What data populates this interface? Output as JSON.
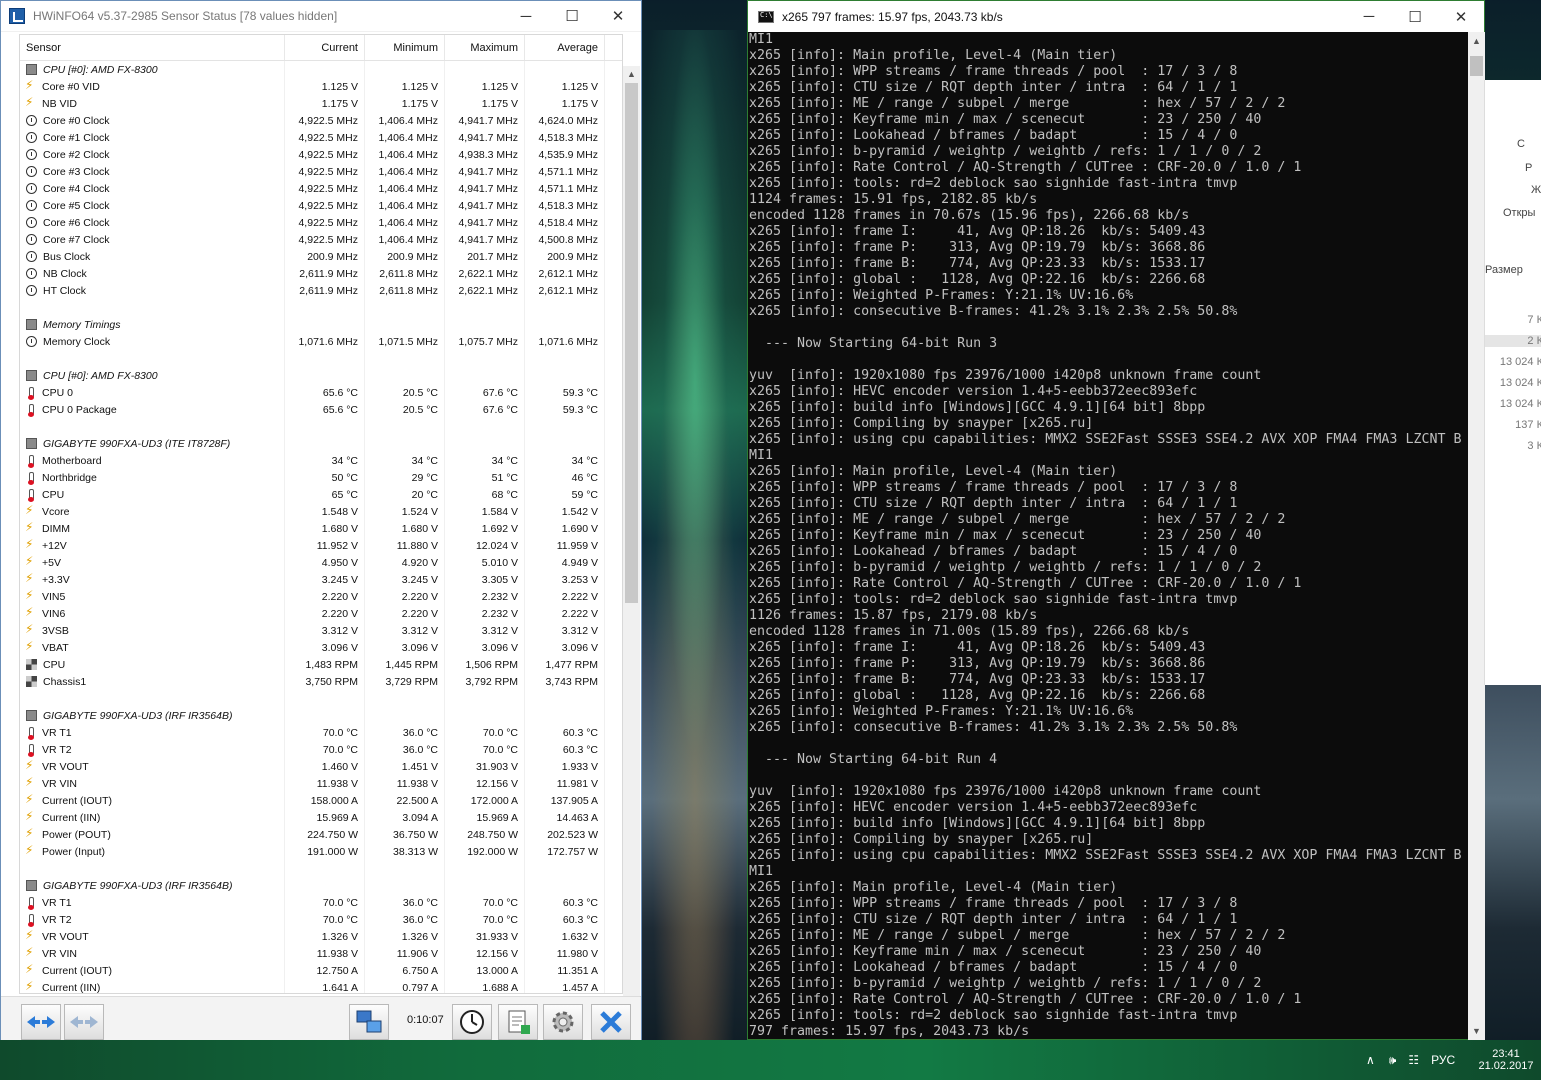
{
  "hwinfo": {
    "title": "HWiNFO64 v5.37-2985 Sensor Status [78 values hidden]",
    "columns": [
      "Sensor",
      "Current",
      "Minimum",
      "Maximum",
      "Average"
    ],
    "rows": [
      {
        "type": "group",
        "icon": "chip-icon",
        "label": "CPU [#0]: AMD FX-8300",
        "cur": "",
        "min": "",
        "max": "",
        "avg": ""
      },
      {
        "type": "row",
        "icon": "voltage-icon",
        "label": "Core #0 VID",
        "cur": "1.125 V",
        "min": "1.125 V",
        "max": "1.125 V",
        "avg": "1.125 V"
      },
      {
        "type": "row",
        "icon": "voltage-icon",
        "label": "NB VID",
        "cur": "1.175 V",
        "min": "1.175 V",
        "max": "1.175 V",
        "avg": "1.175 V"
      },
      {
        "type": "row",
        "icon": "clock-icon",
        "label": "Core #0 Clock",
        "cur": "4,922.5 MHz",
        "min": "1,406.4 MHz",
        "max": "4,941.7 MHz",
        "avg": "4,624.0 MHz"
      },
      {
        "type": "row",
        "icon": "clock-icon",
        "label": "Core #1 Clock",
        "cur": "4,922.5 MHz",
        "min": "1,406.4 MHz",
        "max": "4,941.7 MHz",
        "avg": "4,518.3 MHz"
      },
      {
        "type": "row",
        "icon": "clock-icon",
        "label": "Core #2 Clock",
        "cur": "4,922.5 MHz",
        "min": "1,406.4 MHz",
        "max": "4,938.3 MHz",
        "avg": "4,535.9 MHz"
      },
      {
        "type": "row",
        "icon": "clock-icon",
        "label": "Core #3 Clock",
        "cur": "4,922.5 MHz",
        "min": "1,406.4 MHz",
        "max": "4,941.7 MHz",
        "avg": "4,571.1 MHz"
      },
      {
        "type": "row",
        "icon": "clock-icon",
        "label": "Core #4 Clock",
        "cur": "4,922.5 MHz",
        "min": "1,406.4 MHz",
        "max": "4,941.7 MHz",
        "avg": "4,571.1 MHz"
      },
      {
        "type": "row",
        "icon": "clock-icon",
        "label": "Core #5 Clock",
        "cur": "4,922.5 MHz",
        "min": "1,406.4 MHz",
        "max": "4,941.7 MHz",
        "avg": "4,518.3 MHz"
      },
      {
        "type": "row",
        "icon": "clock-icon",
        "label": "Core #6 Clock",
        "cur": "4,922.5 MHz",
        "min": "1,406.4 MHz",
        "max": "4,941.7 MHz",
        "avg": "4,518.4 MHz"
      },
      {
        "type": "row",
        "icon": "clock-icon",
        "label": "Core #7 Clock",
        "cur": "4,922.5 MHz",
        "min": "1,406.4 MHz",
        "max": "4,941.7 MHz",
        "avg": "4,500.8 MHz"
      },
      {
        "type": "row",
        "icon": "clock-icon",
        "label": "Bus Clock",
        "cur": "200.9 MHz",
        "min": "200.9 MHz",
        "max": "201.7 MHz",
        "avg": "200.9 MHz"
      },
      {
        "type": "row",
        "icon": "clock-icon",
        "label": "NB Clock",
        "cur": "2,611.9 MHz",
        "min": "2,611.8 MHz",
        "max": "2,622.1 MHz",
        "avg": "2,612.1 MHz"
      },
      {
        "type": "row",
        "icon": "clock-icon",
        "label": "HT Clock",
        "cur": "2,611.9 MHz",
        "min": "2,611.8 MHz",
        "max": "2,622.1 MHz",
        "avg": "2,612.1 MHz"
      },
      {
        "type": "blank",
        "icon": "",
        "label": "",
        "cur": "",
        "min": "",
        "max": "",
        "avg": ""
      },
      {
        "type": "group",
        "icon": "chip-icon",
        "label": "Memory Timings",
        "cur": "",
        "min": "",
        "max": "",
        "avg": ""
      },
      {
        "type": "row",
        "icon": "clock-icon",
        "label": "Memory Clock",
        "cur": "1,071.6 MHz",
        "min": "1,071.5 MHz",
        "max": "1,075.7 MHz",
        "avg": "1,071.6 MHz"
      },
      {
        "type": "blank",
        "icon": "",
        "label": "",
        "cur": "",
        "min": "",
        "max": "",
        "avg": ""
      },
      {
        "type": "group",
        "icon": "chip-icon",
        "label": "CPU [#0]: AMD FX-8300",
        "cur": "",
        "min": "",
        "max": "",
        "avg": ""
      },
      {
        "type": "row",
        "icon": "thermometer-icon",
        "label": "CPU 0",
        "cur": "65.6 °C",
        "min": "20.5 °C",
        "max": "67.6 °C",
        "avg": "59.3 °C"
      },
      {
        "type": "row",
        "icon": "thermometer-icon",
        "label": "CPU 0 Package",
        "cur": "65.6 °C",
        "min": "20.5 °C",
        "max": "67.6 °C",
        "avg": "59.3 °C"
      },
      {
        "type": "blank",
        "icon": "",
        "label": "",
        "cur": "",
        "min": "",
        "max": "",
        "avg": ""
      },
      {
        "type": "group",
        "icon": "chip-icon",
        "label": "GIGABYTE 990FXA-UD3 (ITE IT8728F)",
        "cur": "",
        "min": "",
        "max": "",
        "avg": ""
      },
      {
        "type": "row",
        "icon": "thermometer-icon",
        "label": "Motherboard",
        "cur": "34 °C",
        "min": "34 °C",
        "max": "34 °C",
        "avg": "34 °C"
      },
      {
        "type": "row",
        "icon": "thermometer-icon",
        "label": "Northbridge",
        "cur": "50 °C",
        "min": "29 °C",
        "max": "51 °C",
        "avg": "46 °C"
      },
      {
        "type": "row",
        "icon": "thermometer-icon",
        "label": "CPU",
        "cur": "65 °C",
        "min": "20 °C",
        "max": "68 °C",
        "avg": "59 °C"
      },
      {
        "type": "row",
        "icon": "voltage-icon",
        "label": "Vcore",
        "cur": "1.548 V",
        "min": "1.524 V",
        "max": "1.584 V",
        "avg": "1.542 V"
      },
      {
        "type": "row",
        "icon": "voltage-icon",
        "label": "DIMM",
        "cur": "1.680 V",
        "min": "1.680 V",
        "max": "1.692 V",
        "avg": "1.690 V"
      },
      {
        "type": "row",
        "icon": "voltage-icon",
        "label": "+12V",
        "cur": "11.952 V",
        "min": "11.880 V",
        "max": "12.024 V",
        "avg": "11.959 V"
      },
      {
        "type": "row",
        "icon": "voltage-icon",
        "label": "+5V",
        "cur": "4.950 V",
        "min": "4.920 V",
        "max": "5.010 V",
        "avg": "4.949 V"
      },
      {
        "type": "row",
        "icon": "voltage-icon",
        "label": "+3.3V",
        "cur": "3.245 V",
        "min": "3.245 V",
        "max": "3.305 V",
        "avg": "3.253 V"
      },
      {
        "type": "row",
        "icon": "voltage-icon",
        "label": "VIN5",
        "cur": "2.220 V",
        "min": "2.220 V",
        "max": "2.232 V",
        "avg": "2.222 V"
      },
      {
        "type": "row",
        "icon": "voltage-icon",
        "label": "VIN6",
        "cur": "2.220 V",
        "min": "2.220 V",
        "max": "2.232 V",
        "avg": "2.222 V"
      },
      {
        "type": "row",
        "icon": "voltage-icon",
        "label": "3VSB",
        "cur": "3.312 V",
        "min": "3.312 V",
        "max": "3.312 V",
        "avg": "3.312 V"
      },
      {
        "type": "row",
        "icon": "voltage-icon",
        "label": "VBAT",
        "cur": "3.096 V",
        "min": "3.096 V",
        "max": "3.096 V",
        "avg": "3.096 V"
      },
      {
        "type": "row",
        "icon": "fan-icon",
        "label": "CPU",
        "cur": "1,483 RPM",
        "min": "1,445 RPM",
        "max": "1,506 RPM",
        "avg": "1,477 RPM"
      },
      {
        "type": "row",
        "icon": "fan-icon",
        "label": "Chassis1",
        "cur": "3,750 RPM",
        "min": "3,729 RPM",
        "max": "3,792 RPM",
        "avg": "3,743 RPM"
      },
      {
        "type": "blank",
        "icon": "",
        "label": "",
        "cur": "",
        "min": "",
        "max": "",
        "avg": ""
      },
      {
        "type": "group",
        "icon": "chip-icon",
        "label": "GIGABYTE 990FXA-UD3 (IRF IR3564B)",
        "cur": "",
        "min": "",
        "max": "",
        "avg": ""
      },
      {
        "type": "row",
        "icon": "thermometer-icon",
        "label": "VR T1",
        "cur": "70.0 °C",
        "min": "36.0 °C",
        "max": "70.0 °C",
        "avg": "60.3 °C"
      },
      {
        "type": "row",
        "icon": "thermometer-icon",
        "label": "VR T2",
        "cur": "70.0 °C",
        "min": "36.0 °C",
        "max": "70.0 °C",
        "avg": "60.3 °C"
      },
      {
        "type": "row",
        "icon": "voltage-icon",
        "label": "VR VOUT",
        "cur": "1.460 V",
        "min": "1.451 V",
        "max": "31.903 V",
        "avg": "1.933 V"
      },
      {
        "type": "row",
        "icon": "voltage-icon",
        "label": "VR VIN",
        "cur": "11.938 V",
        "min": "11.938 V",
        "max": "12.156 V",
        "avg": "11.981 V"
      },
      {
        "type": "row",
        "icon": "voltage-icon",
        "label": "Current (IOUT)",
        "cur": "158.000 A",
        "min": "22.500 A",
        "max": "172.000 A",
        "avg": "137.905 A"
      },
      {
        "type": "row",
        "icon": "voltage-icon",
        "label": "Current (IIN)",
        "cur": "15.969 A",
        "min": "3.094 A",
        "max": "15.969 A",
        "avg": "14.463 A"
      },
      {
        "type": "row",
        "icon": "voltage-icon",
        "label": "Power (POUT)",
        "cur": "224.750 W",
        "min": "36.750 W",
        "max": "248.750 W",
        "avg": "202.523 W"
      },
      {
        "type": "row",
        "icon": "voltage-icon",
        "label": "Power (Input)",
        "cur": "191.000 W",
        "min": "38.313 W",
        "max": "192.000 W",
        "avg": "172.757 W"
      },
      {
        "type": "blank",
        "icon": "",
        "label": "",
        "cur": "",
        "min": "",
        "max": "",
        "avg": ""
      },
      {
        "type": "group",
        "icon": "chip-icon",
        "label": "GIGABYTE 990FXA-UD3 (IRF IR3564B)",
        "cur": "",
        "min": "",
        "max": "",
        "avg": ""
      },
      {
        "type": "row",
        "icon": "thermometer-icon",
        "label": "VR T1",
        "cur": "70.0 °C",
        "min": "36.0 °C",
        "max": "70.0 °C",
        "avg": "60.3 °C"
      },
      {
        "type": "row",
        "icon": "thermometer-icon",
        "label": "VR T2",
        "cur": "70.0 °C",
        "min": "36.0 °C",
        "max": "70.0 °C",
        "avg": "60.3 °C"
      },
      {
        "type": "row",
        "icon": "voltage-icon",
        "label": "VR VOUT",
        "cur": "1.326 V",
        "min": "1.326 V",
        "max": "31.933 V",
        "avg": "1.632 V"
      },
      {
        "type": "row",
        "icon": "voltage-icon",
        "label": "VR VIN",
        "cur": "11.938 V",
        "min": "11.906 V",
        "max": "12.156 V",
        "avg": "11.980 V"
      },
      {
        "type": "row",
        "icon": "voltage-icon",
        "label": "Current (IOUT)",
        "cur": "12.750 A",
        "min": "6.750 A",
        "max": "13.000 A",
        "avg": "11.351 A"
      },
      {
        "type": "row",
        "icon": "voltage-icon",
        "label": "Current (IIN)",
        "cur": "1.641 A",
        "min": "0.797 A",
        "max": "1.688 A",
        "avg": "1.457 A"
      }
    ],
    "elapsed": "0:10:07",
    "toolbar_icons": [
      "nav-arrows-icon",
      "nav-arrows-disabled-icon",
      "network-icon",
      "clock-icon",
      "report-icon",
      "settings-icon",
      "close-icon"
    ]
  },
  "console": {
    "title": "x265 797 frames: 15.97 fps, 2043.73 kb/s",
    "lines": [
      "MI1",
      "x265 [info]: Main profile, Level-4 (Main tier)",
      "x265 [info]: WPP streams / frame threads / pool  : 17 / 3 / 8",
      "x265 [info]: CTU size / RQT depth inter / intra  : 64 / 1 / 1",
      "x265 [info]: ME / range / subpel / merge         : hex / 57 / 2 / 2",
      "x265 [info]: Keyframe min / max / scenecut       : 23 / 250 / 40",
      "x265 [info]: Lookahead / bframes / badapt        : 15 / 4 / 0",
      "x265 [info]: b-pyramid / weightp / weightb / refs: 1 / 1 / 0 / 2",
      "x265 [info]: Rate Control / AQ-Strength / CUTree : CRF-20.0 / 1.0 / 1",
      "x265 [info]: tools: rd=2 deblock sao signhide fast-intra tmvp",
      "1124 frames: 15.91 fps, 2182.85 kb/s",
      "encoded 1128 frames in 70.67s (15.96 fps), 2266.68 kb/s",
      "x265 [info]: frame I:     41, Avg QP:18.26  kb/s: 5409.43",
      "x265 [info]: frame P:    313, Avg QP:19.79  kb/s: 3668.86",
      "x265 [info]: frame B:    774, Avg QP:23.33  kb/s: 1533.17",
      "x265 [info]: global :   1128, Avg QP:22.16  kb/s: 2266.68",
      "x265 [info]: Weighted P-Frames: Y:21.1% UV:16.6%",
      "x265 [info]: consecutive B-frames: 41.2% 3.1% 2.3% 2.5% 50.8%",
      "",
      "  --- Now Starting 64-bit Run 3",
      "",
      "yuv  [info]: 1920x1080 fps 23976/1000 i420p8 unknown frame count",
      "x265 [info]: HEVC encoder version 1.4+5-eebb372eec893efc",
      "x265 [info]: build info [Windows][GCC 4.9.1][64 bit] 8bpp",
      "x265 [info]: Compiling by snayper [x265.ru]",
      "x265 [info]: using cpu capabilities: MMX2 SSE2Fast SSSE3 SSE4.2 AVX XOP FMA4 FMA3 LZCNT B",
      "MI1",
      "x265 [info]: Main profile, Level-4 (Main tier)",
      "x265 [info]: WPP streams / frame threads / pool  : 17 / 3 / 8",
      "x265 [info]: CTU size / RQT depth inter / intra  : 64 / 1 / 1",
      "x265 [info]: ME / range / subpel / merge         : hex / 57 / 2 / 2",
      "x265 [info]: Keyframe min / max / scenecut       : 23 / 250 / 40",
      "x265 [info]: Lookahead / bframes / badapt        : 15 / 4 / 0",
      "x265 [info]: b-pyramid / weightp / weightb / refs: 1 / 1 / 0 / 2",
      "x265 [info]: Rate Control / AQ-Strength / CUTree : CRF-20.0 / 1.0 / 1",
      "x265 [info]: tools: rd=2 deblock sao signhide fast-intra tmvp",
      "1126 frames: 15.87 fps, 2179.08 kb/s",
      "encoded 1128 frames in 71.00s (15.89 fps), 2266.68 kb/s",
      "x265 [info]: frame I:     41, Avg QP:18.26  kb/s: 5409.43",
      "x265 [info]: frame P:    313, Avg QP:19.79  kb/s: 3668.86",
      "x265 [info]: frame B:    774, Avg QP:23.33  kb/s: 1533.17",
      "x265 [info]: global :   1128, Avg QP:22.16  kb/s: 2266.68",
      "x265 [info]: Weighted P-Frames: Y:21.1% UV:16.6%",
      "x265 [info]: consecutive B-frames: 41.2% 3.1% 2.3% 2.5% 50.8%",
      "",
      "  --- Now Starting 64-bit Run 4",
      "",
      "yuv  [info]: 1920x1080 fps 23976/1000 i420p8 unknown frame count",
      "x265 [info]: HEVC encoder version 1.4+5-eebb372eec893efc",
      "x265 [info]: build info [Windows][GCC 4.9.1][64 bit] 8bpp",
      "x265 [info]: Compiling by snayper [x265.ru]",
      "x265 [info]: using cpu capabilities: MMX2 SSE2Fast SSSE3 SSE4.2 AVX XOP FMA4 FMA3 LZCNT B",
      "MI1",
      "x265 [info]: Main profile, Level-4 (Main tier)",
      "x265 [info]: WPP streams / frame threads / pool  : 17 / 3 / 8",
      "x265 [info]: CTU size / RQT depth inter / intra  : 64 / 1 / 1",
      "x265 [info]: ME / range / subpel / merge         : hex / 57 / 2 / 2",
      "x265 [info]: Keyframe min / max / scenecut       : 23 / 250 / 40",
      "x265 [info]: Lookahead / bframes / badapt        : 15 / 4 / 0",
      "x265 [info]: b-pyramid / weightp / weightb / refs: 1 / 1 / 0 / 2",
      "x265 [info]: Rate Control / AQ-Strength / CUTree : CRF-20.0 / 1.0 / 1",
      "x265 [info]: tools: rd=2 deblock sao signhide fast-intra tmvp",
      "797 frames: 15.97 fps, 2043.73 kb/s"
    ]
  },
  "explorer": {
    "items": [
      "С",
      "Р",
      "Ж"
    ],
    "open_label": "Откры",
    "size_header": "Размер",
    "sizes": [
      "7 К",
      "2 К",
      "13 024 К",
      "13 024 К",
      "13 024 К",
      "137 К",
      "3 К"
    ]
  },
  "taskbar": {
    "language": "РУС",
    "time": "23:41",
    "date": "21.02.2017",
    "accent_color": "#127a44"
  }
}
